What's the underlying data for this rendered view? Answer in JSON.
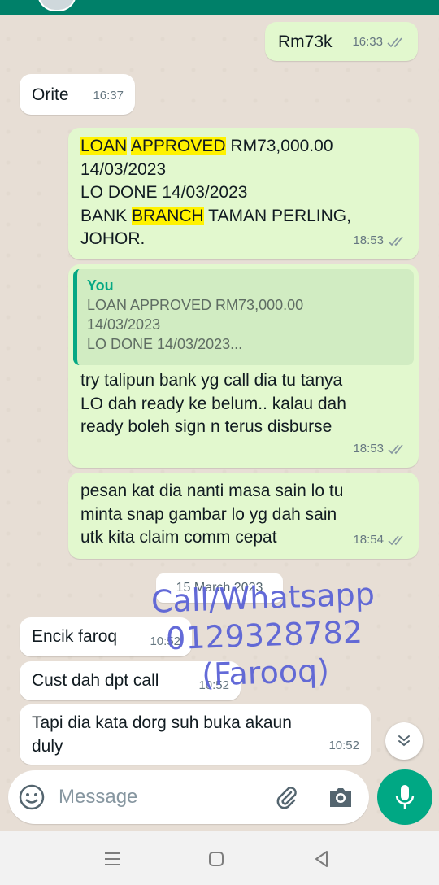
{
  "messages": [
    {
      "text": "Rm73k",
      "time": "16:33"
    },
    {
      "text": "Orite",
      "time": "16:37"
    },
    {
      "time": "18:53",
      "lines": [
        {
          "parts": [
            "LOAN",
            " ",
            "APPROVED",
            " RM73,000.00"
          ]
        },
        {
          "parts": [
            "14/03/2023"
          ]
        },
        {
          "parts": [
            "LO DONE 14/03/2023"
          ]
        },
        {
          "parts": [
            "BANK ",
            "BRANCH",
            " TAMAN PERLING,"
          ]
        },
        {
          "parts": [
            "JOHOR."
          ]
        }
      ]
    },
    {
      "quote_author": "You",
      "quote_text": "LOAN APPROVED RM73,000.00\n14/03/2023\nLO DONE 14/03/2023...",
      "text": "try talipun bank yg call dia tu tanya\nLO dah ready ke belum.. kalau dah\nready boleh sign n terus disburse",
      "time": "18:53"
    },
    {
      "text": "pesan kat dia nanti masa sain lo tu\nminta snap gambar lo yg dah sain\nutk kita claim comm cepat",
      "time": "18:54"
    },
    {
      "text": "Encik faroq",
      "time": "10:52"
    },
    {
      "text": "Cust dah dpt call",
      "time": "10:52"
    },
    {
      "text": "Tapi dia kata dorg suh buka akaun\nduly",
      "time": "10:52"
    }
  ],
  "date_divider": "15 March 2023",
  "watermark": {
    "line1": "Call/Whatsapp",
    "line2": "0129328782",
    "line3": "(Farooq)"
  },
  "composer": {
    "placeholder": "Message"
  },
  "colors": {
    "outgoing": "#e2f8ce",
    "incoming": "#ffffff",
    "accent": "#00a884",
    "highlight": "#fff200"
  },
  "icons": [
    "emoji-icon",
    "attach-icon",
    "camera-icon",
    "mic-icon",
    "scroll-down-icon",
    "read-receipt-icon",
    "nav-recents-icon",
    "nav-home-icon",
    "nav-back-icon"
  ]
}
